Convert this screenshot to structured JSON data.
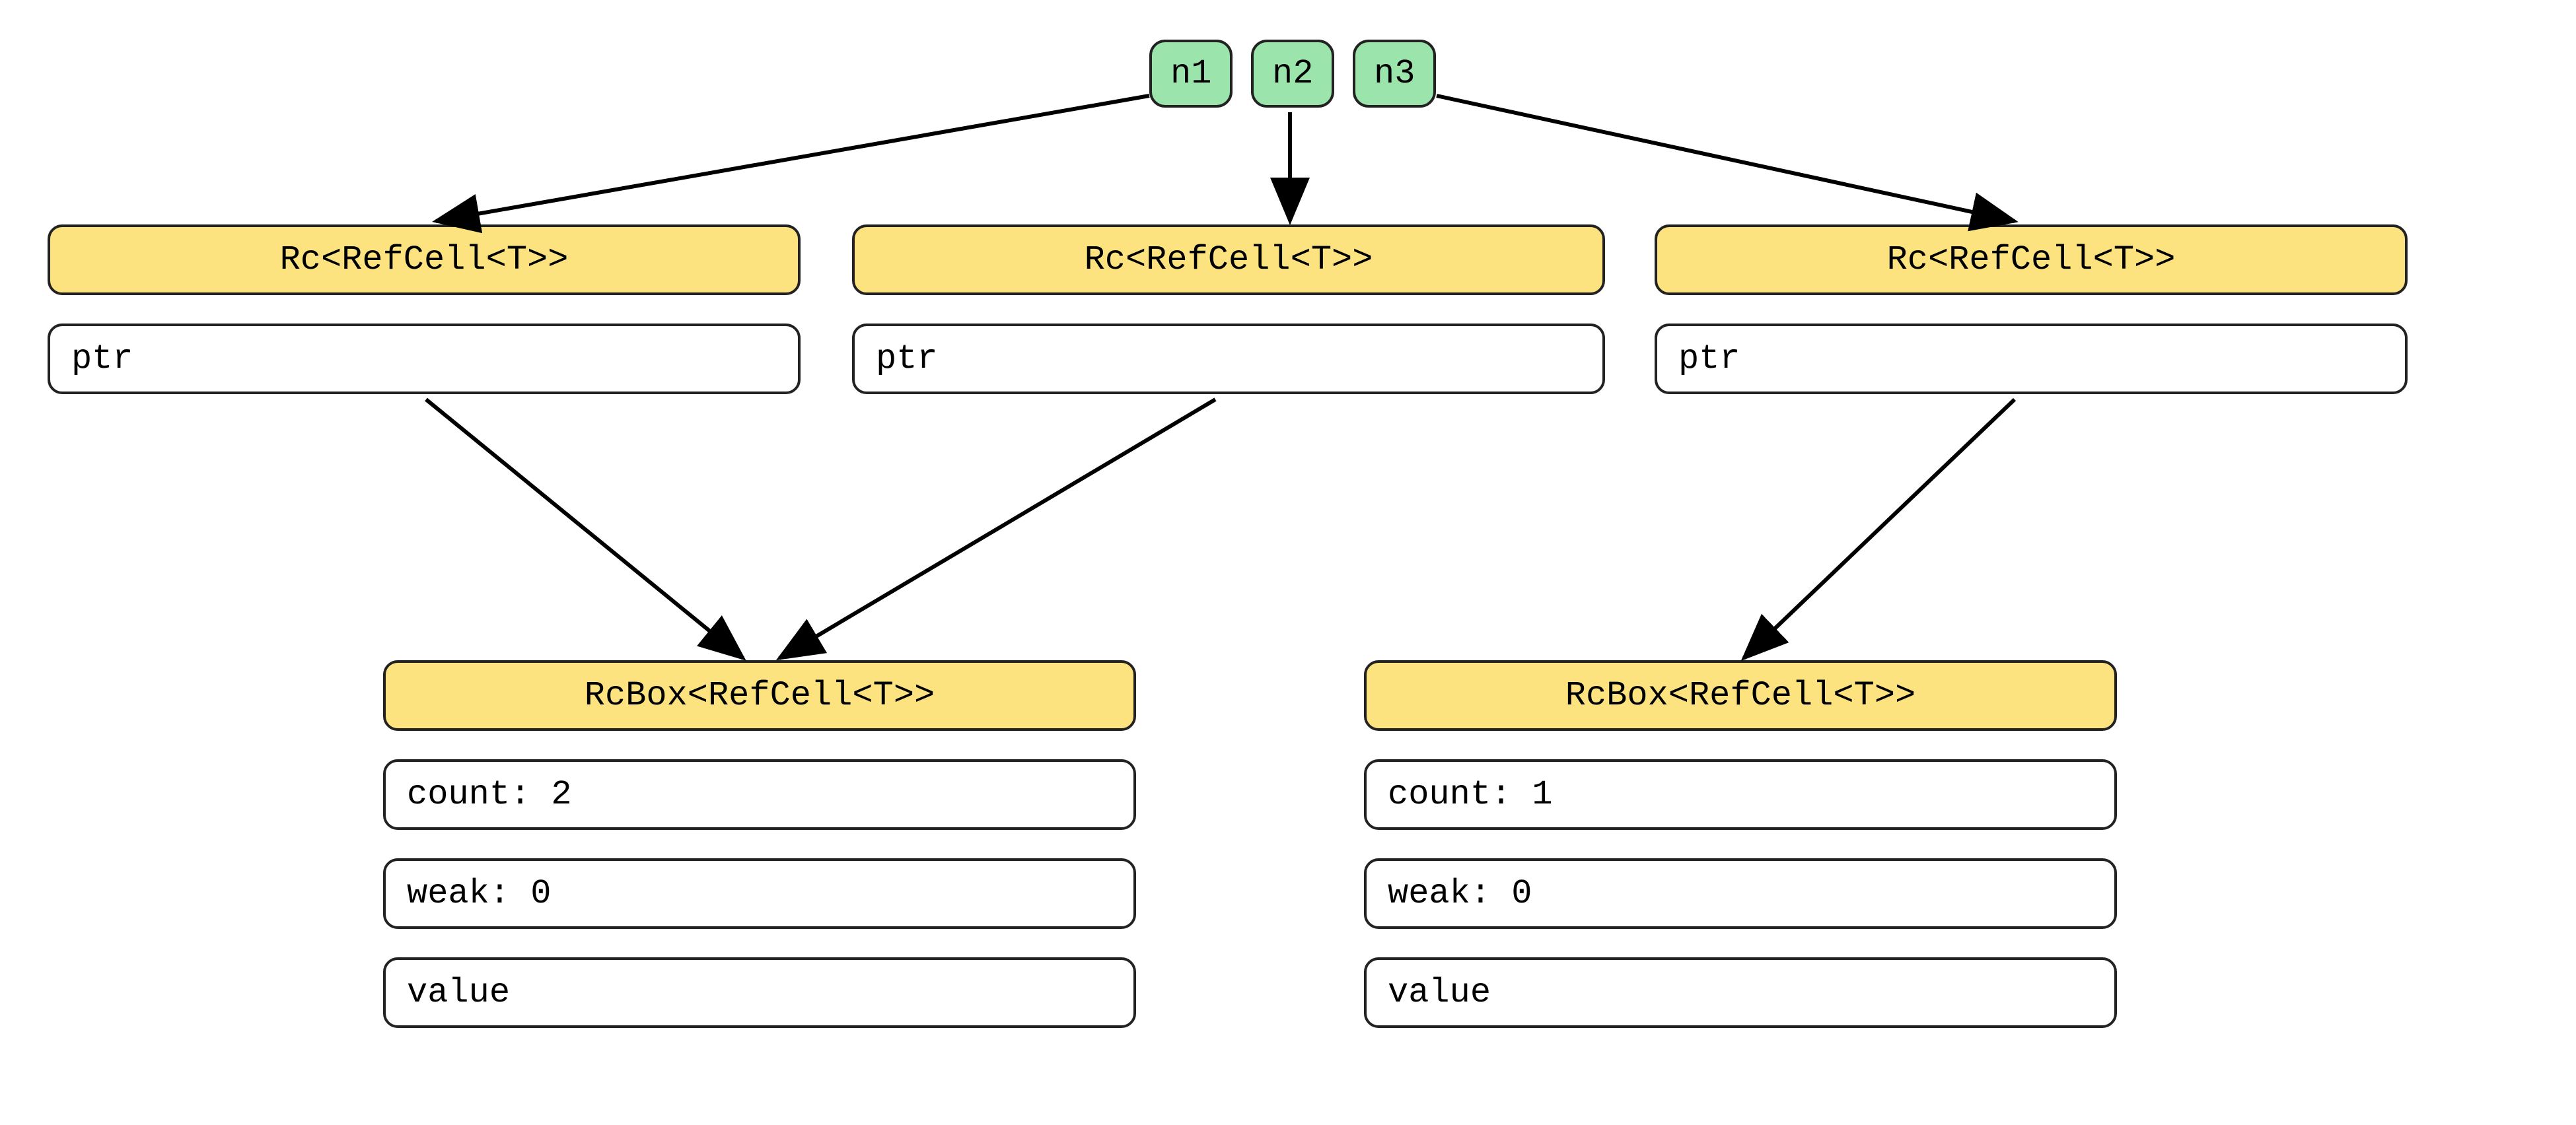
{
  "nodes": {
    "n1": "n1",
    "n2": "n2",
    "n3": "n3"
  },
  "rc": {
    "header": "Rc<RefCell<T>>",
    "ptr": "ptr"
  },
  "rcbox": {
    "header": "RcBox<RefCell<T>>",
    "left": {
      "count": "count: 2",
      "weak": "weak: 0",
      "value": "value"
    },
    "right": {
      "count": "count: 1",
      "weak": "weak: 0",
      "value": "value"
    }
  }
}
